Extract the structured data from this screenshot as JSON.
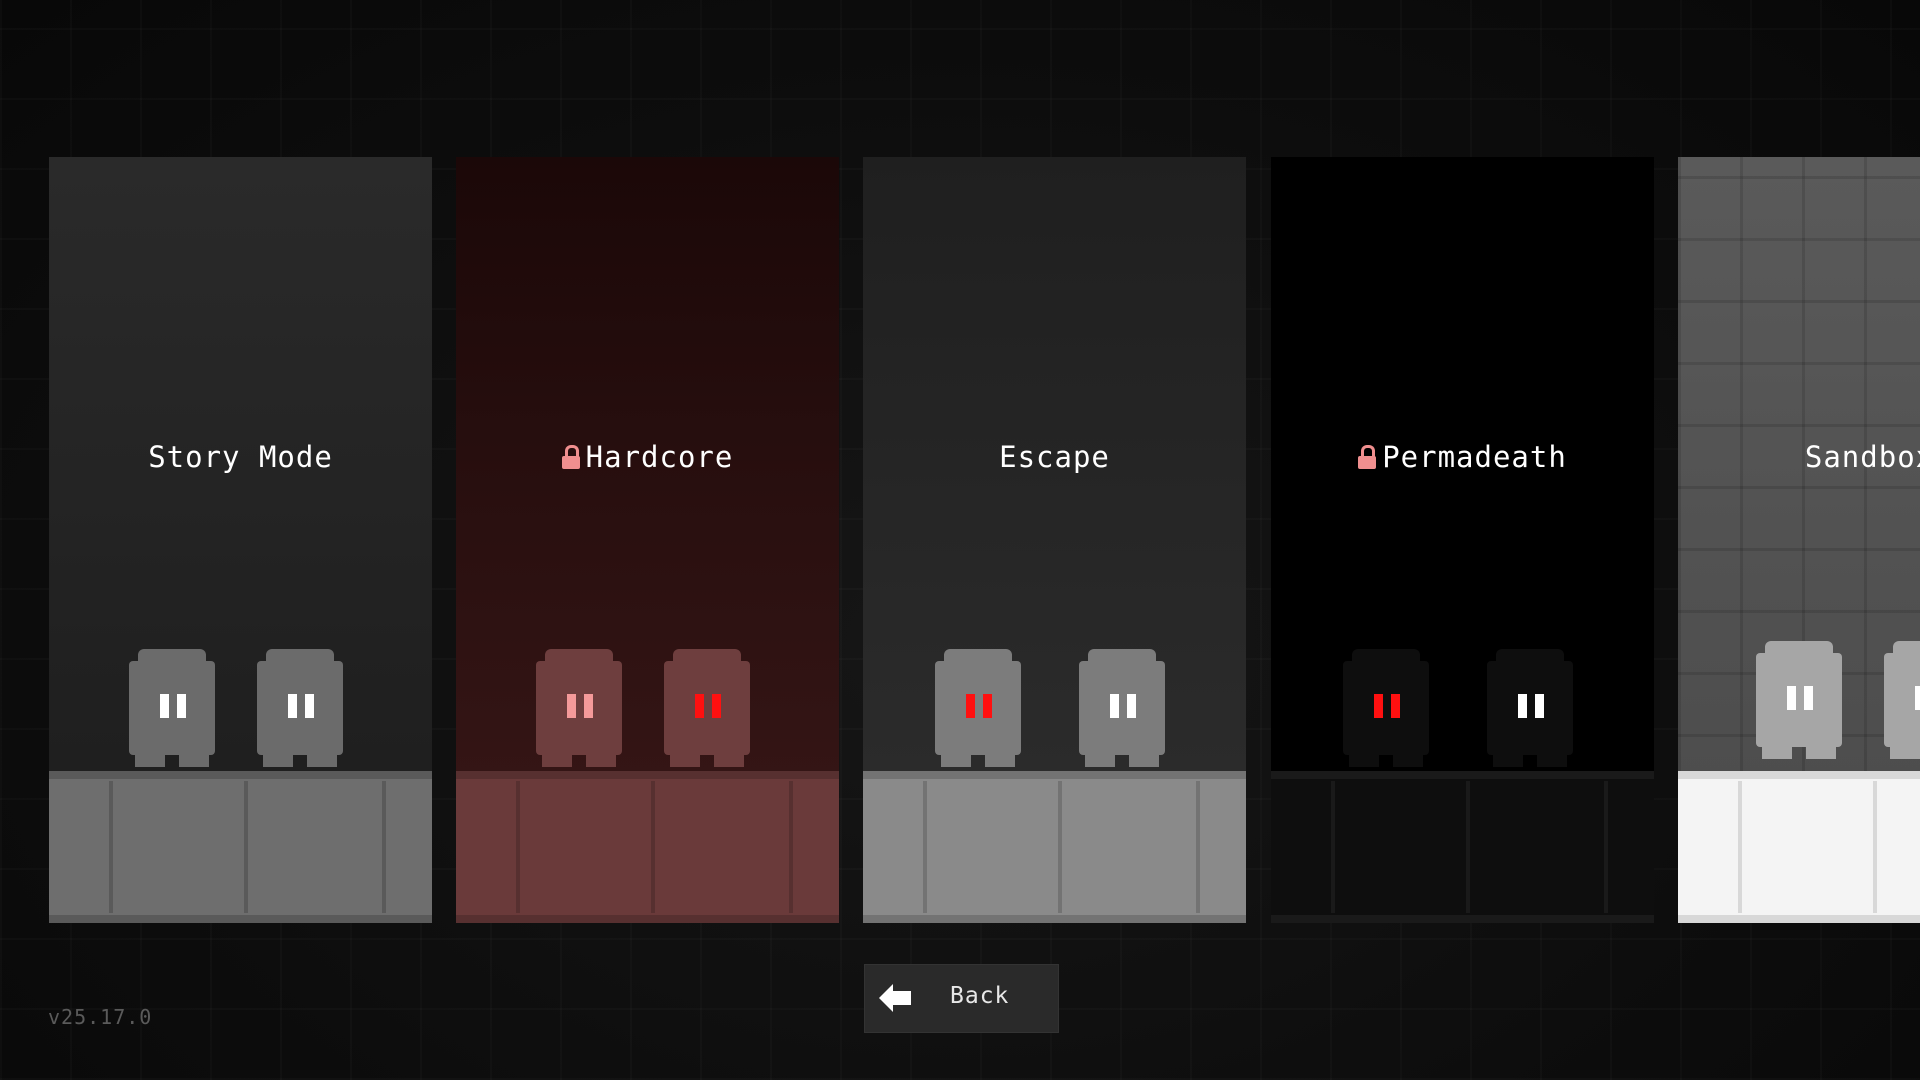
{
  "modes": [
    {
      "id": "story",
      "label": "Story Mode",
      "locked": false,
      "theme": {
        "bg_top": "#2a2a2a",
        "bg_bottom": "#1c1c1c",
        "floor": "#6e6e6e",
        "floor_line": "#5a5a5a",
        "ghost": "#6b6b6b"
      },
      "ghosts": [
        {
          "eye_color": "#ffffff"
        },
        {
          "eye_color": "#ffffff"
        }
      ]
    },
    {
      "id": "hardcore",
      "label": "Hardcore",
      "locked": true,
      "theme": {
        "bg_top": "#1b0808",
        "bg_bottom": "#3a1818",
        "floor": "#6a3a3a",
        "floor_line": "#573030",
        "ghost": "#6e3e3e"
      },
      "ghosts": [
        {
          "eye_color": "#f49a9a"
        },
        {
          "eye_color": "#ff1010"
        }
      ]
    },
    {
      "id": "escape",
      "label": "Escape",
      "locked": false,
      "theme": {
        "bg_top": "#1f1f1f",
        "bg_bottom": "#2e2e2e",
        "floor": "#8a8a8a",
        "floor_line": "#737373",
        "ghost": "#7c7c7c"
      },
      "ghosts": [
        {
          "eye_color": "#ff1010"
        },
        {
          "eye_color": "#ffffff"
        }
      ]
    },
    {
      "id": "permadeath",
      "label": "Permadeath",
      "locked": true,
      "theme": {
        "bg_top": "#000000",
        "bg_bottom": "#000000",
        "floor": "#0e0e0e",
        "floor_line": "#1a1a1a",
        "ghost": "#0e0e0e"
      },
      "ghosts": [
        {
          "eye_color": "#ff1010"
        },
        {
          "eye_color": "#ffffff"
        }
      ]
    },
    {
      "id": "sandbox",
      "label": "Sandbox",
      "locked": false,
      "theme": {
        "bg_top": "#5a5a5a",
        "bg_bottom": "#4a4a4a",
        "floor": "#f4f4f4",
        "floor_line": "#d8d8d8",
        "ghost": "#a6a6a6"
      },
      "ghosts": [
        {
          "eye_color": "#ffffff"
        },
        {
          "eye_color": "#ffffff"
        }
      ]
    }
  ],
  "back_button": {
    "label": "Back",
    "icon": "arrow-left-icon"
  },
  "version": "v25.17.0",
  "icons": {
    "lock": "lock-icon"
  }
}
